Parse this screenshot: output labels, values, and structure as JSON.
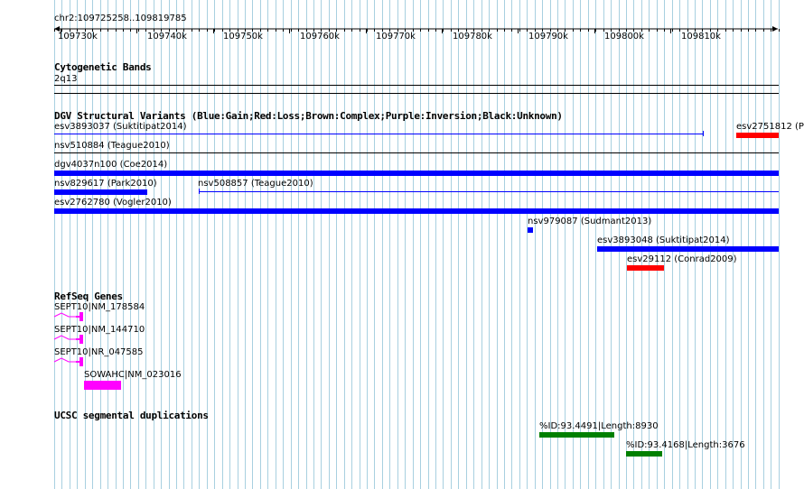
{
  "ruler": {
    "range_label": "chr2:109725258..109819785",
    "ticks": [
      "109730k",
      "109740k",
      "109750k",
      "109760k",
      "109770k",
      "109780k",
      "109790k",
      "109800k",
      "109810k"
    ]
  },
  "tracks": {
    "cytoband": {
      "title": "Cytogenetic Bands",
      "band_label": "2q13"
    },
    "dgv": {
      "title": "DGV Structural Variants (Blue:Gain;Red:Loss;Brown:Complex;Purple:Inversion;Black:Unknown)",
      "features": [
        {
          "id": "esv3893037",
          "label": "esv3893037 (Suktitipat2014)"
        },
        {
          "id": "esv2751812",
          "label": "esv2751812 (P"
        },
        {
          "id": "nsv510884",
          "label": "nsv510884 (Teague2010)"
        },
        {
          "id": "dgv4037n100",
          "label": "dgv4037n100 (Coe2014)"
        },
        {
          "id": "nsv829617",
          "label": "nsv829617 (Park2010)"
        },
        {
          "id": "nsv508857",
          "label": "nsv508857 (Teague2010)"
        },
        {
          "id": "esv2762780",
          "label": "esv2762780 (Vogler2010)"
        },
        {
          "id": "nsv979087",
          "label": "nsv979087 (Sudmant2013)"
        },
        {
          "id": "esv3893048",
          "label": "esv3893048 (Suktitipat2014)"
        },
        {
          "id": "esv29112",
          "label": "esv29112 (Conrad2009)"
        }
      ]
    },
    "refseq": {
      "title": "RefSeq Genes",
      "features": [
        {
          "label": "SEPT10|NM_178584"
        },
        {
          "label": "SEPT10|NM_144710"
        },
        {
          "label": "SEPT10|NR_047585"
        },
        {
          "label": "SOWAHC|NM_023016"
        }
      ]
    },
    "segdup": {
      "title": "UCSC segmental duplications",
      "features": [
        {
          "label": "%ID:93.4491|Length:8930"
        },
        {
          "label": "%ID:93.4168|Length:3676"
        }
      ]
    }
  },
  "colors": {
    "gain": "#0000ff",
    "loss": "#ff0000",
    "gene": "#ff00ff",
    "segdup": "#008000",
    "grid": "#a8d0e0",
    "grid_major": "#88b8cc"
  }
}
